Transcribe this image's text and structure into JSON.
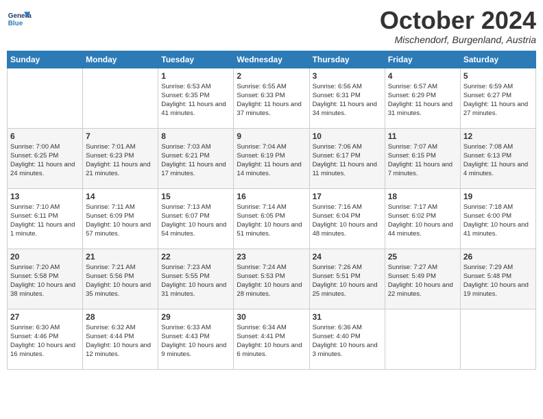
{
  "logo": {
    "general": "General",
    "blue": "Blue"
  },
  "header": {
    "month": "October 2024",
    "location": "Mischendorf, Burgenland, Austria"
  },
  "weekdays": [
    "Sunday",
    "Monday",
    "Tuesday",
    "Wednesday",
    "Thursday",
    "Friday",
    "Saturday"
  ],
  "weeks": [
    [
      {
        "day": "",
        "info": ""
      },
      {
        "day": "",
        "info": ""
      },
      {
        "day": "1",
        "info": "Sunrise: 6:53 AM\nSunset: 6:35 PM\nDaylight: 11 hours and 41 minutes."
      },
      {
        "day": "2",
        "info": "Sunrise: 6:55 AM\nSunset: 6:33 PM\nDaylight: 11 hours and 37 minutes."
      },
      {
        "day": "3",
        "info": "Sunrise: 6:56 AM\nSunset: 6:31 PM\nDaylight: 11 hours and 34 minutes."
      },
      {
        "day": "4",
        "info": "Sunrise: 6:57 AM\nSunset: 6:29 PM\nDaylight: 11 hours and 31 minutes."
      },
      {
        "day": "5",
        "info": "Sunrise: 6:59 AM\nSunset: 6:27 PM\nDaylight: 11 hours and 27 minutes."
      }
    ],
    [
      {
        "day": "6",
        "info": "Sunrise: 7:00 AM\nSunset: 6:25 PM\nDaylight: 11 hours and 24 minutes."
      },
      {
        "day": "7",
        "info": "Sunrise: 7:01 AM\nSunset: 6:23 PM\nDaylight: 11 hours and 21 minutes."
      },
      {
        "day": "8",
        "info": "Sunrise: 7:03 AM\nSunset: 6:21 PM\nDaylight: 11 hours and 17 minutes."
      },
      {
        "day": "9",
        "info": "Sunrise: 7:04 AM\nSunset: 6:19 PM\nDaylight: 11 hours and 14 minutes."
      },
      {
        "day": "10",
        "info": "Sunrise: 7:06 AM\nSunset: 6:17 PM\nDaylight: 11 hours and 11 minutes."
      },
      {
        "day": "11",
        "info": "Sunrise: 7:07 AM\nSunset: 6:15 PM\nDaylight: 11 hours and 7 minutes."
      },
      {
        "day": "12",
        "info": "Sunrise: 7:08 AM\nSunset: 6:13 PM\nDaylight: 11 hours and 4 minutes."
      }
    ],
    [
      {
        "day": "13",
        "info": "Sunrise: 7:10 AM\nSunset: 6:11 PM\nDaylight: 11 hours and 1 minute."
      },
      {
        "day": "14",
        "info": "Sunrise: 7:11 AM\nSunset: 6:09 PM\nDaylight: 10 hours and 57 minutes."
      },
      {
        "day": "15",
        "info": "Sunrise: 7:13 AM\nSunset: 6:07 PM\nDaylight: 10 hours and 54 minutes."
      },
      {
        "day": "16",
        "info": "Sunrise: 7:14 AM\nSunset: 6:05 PM\nDaylight: 10 hours and 51 minutes."
      },
      {
        "day": "17",
        "info": "Sunrise: 7:16 AM\nSunset: 6:04 PM\nDaylight: 10 hours and 48 minutes."
      },
      {
        "day": "18",
        "info": "Sunrise: 7:17 AM\nSunset: 6:02 PM\nDaylight: 10 hours and 44 minutes."
      },
      {
        "day": "19",
        "info": "Sunrise: 7:18 AM\nSunset: 6:00 PM\nDaylight: 10 hours and 41 minutes."
      }
    ],
    [
      {
        "day": "20",
        "info": "Sunrise: 7:20 AM\nSunset: 5:58 PM\nDaylight: 10 hours and 38 minutes."
      },
      {
        "day": "21",
        "info": "Sunrise: 7:21 AM\nSunset: 5:56 PM\nDaylight: 10 hours and 35 minutes."
      },
      {
        "day": "22",
        "info": "Sunrise: 7:23 AM\nSunset: 5:55 PM\nDaylight: 10 hours and 31 minutes."
      },
      {
        "day": "23",
        "info": "Sunrise: 7:24 AM\nSunset: 5:53 PM\nDaylight: 10 hours and 28 minutes."
      },
      {
        "day": "24",
        "info": "Sunrise: 7:26 AM\nSunset: 5:51 PM\nDaylight: 10 hours and 25 minutes."
      },
      {
        "day": "25",
        "info": "Sunrise: 7:27 AM\nSunset: 5:49 PM\nDaylight: 10 hours and 22 minutes."
      },
      {
        "day": "26",
        "info": "Sunrise: 7:29 AM\nSunset: 5:48 PM\nDaylight: 10 hours and 19 minutes."
      }
    ],
    [
      {
        "day": "27",
        "info": "Sunrise: 6:30 AM\nSunset: 4:46 PM\nDaylight: 10 hours and 16 minutes."
      },
      {
        "day": "28",
        "info": "Sunrise: 6:32 AM\nSunset: 4:44 PM\nDaylight: 10 hours and 12 minutes."
      },
      {
        "day": "29",
        "info": "Sunrise: 6:33 AM\nSunset: 4:43 PM\nDaylight: 10 hours and 9 minutes."
      },
      {
        "day": "30",
        "info": "Sunrise: 6:34 AM\nSunset: 4:41 PM\nDaylight: 10 hours and 6 minutes."
      },
      {
        "day": "31",
        "info": "Sunrise: 6:36 AM\nSunset: 4:40 PM\nDaylight: 10 hours and 3 minutes."
      },
      {
        "day": "",
        "info": ""
      },
      {
        "day": "",
        "info": ""
      }
    ]
  ]
}
